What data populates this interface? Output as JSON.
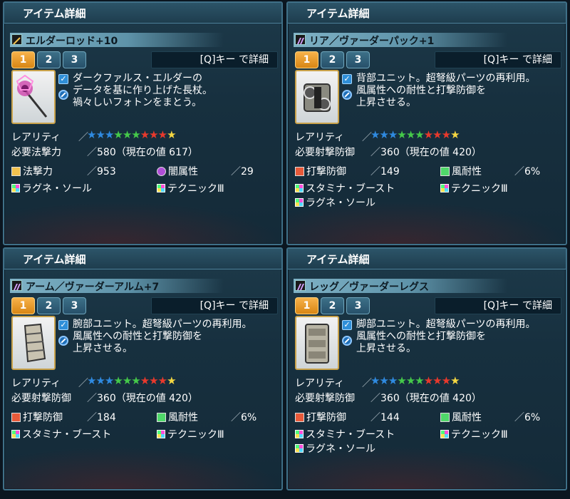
{
  "panels": [
    {
      "title": "アイテム詳細",
      "item_name": "エルダーロッド+10",
      "tabs": [
        "1",
        "2",
        "3"
      ],
      "detail_button": "[Q]キー で詳細",
      "description": "ダークファルス・エルダーの\nデータを基に作り上げた長杖。\n禍々しいフォトンをまとう。",
      "rarity_label": "レアリティ",
      "rarity_stars": 10,
      "req_label": "必要法撃力",
      "req_value": "580（現在の値 617）",
      "stat1_label": "法撃力",
      "stat1_value": "953",
      "stat2_label": "闇属性",
      "stat2_value": "29",
      "abilities": [
        "ラグネ・ソール",
        "テクニックⅢ"
      ],
      "thumb": "rod-icon"
    },
    {
      "title": "アイテム詳細",
      "item_name": "リア／ヴァーダーパック+1",
      "tabs": [
        "1",
        "2",
        "3"
      ],
      "detail_button": "[Q]キー で詳細",
      "description": "背部ユニット。超弩級パーツの再利用。\n風属性への耐性と打撃防御を\n上昇させる。",
      "rarity_label": "レアリティ",
      "rarity_stars": 10,
      "req_label": "必要射撃防御",
      "req_value": "360（現在の値 420）",
      "stat1_label": "打撃防御",
      "stat1_value": "149",
      "stat2_label": "風耐性",
      "stat2_value": "6%",
      "abilities": [
        "スタミナ・ブースト",
        "テクニックⅢ",
        "ラグネ・ソール"
      ],
      "thumb": "rear-unit-icon"
    },
    {
      "title": "アイテム詳細",
      "item_name": "アーム／ヴァーダーアルム+7",
      "tabs": [
        "1",
        "2",
        "3"
      ],
      "detail_button": "[Q]キー で詳細",
      "description": "腕部ユニット。超弩級パーツの再利用。\n風属性への耐性と打撃防御を\n上昇させる。",
      "rarity_label": "レアリティ",
      "rarity_stars": 10,
      "req_label": "必要射撃防御",
      "req_value": "360（現在の値 420）",
      "stat1_label": "打撃防御",
      "stat1_value": "184",
      "stat2_label": "風耐性",
      "stat2_value": "6%",
      "abilities": [
        "スタミナ・ブースト",
        "テクニックⅢ"
      ],
      "thumb": "arm-unit-icon"
    },
    {
      "title": "アイテム詳細",
      "item_name": "レッグ／ヴァーダーレグス",
      "tabs": [
        "1",
        "2",
        "3"
      ],
      "detail_button": "[Q]キー で詳細",
      "description": "脚部ユニット。超弩級パーツの再利用。\n風属性への耐性と打撃防御を\n上昇させる。",
      "rarity_label": "レアリティ",
      "rarity_stars": 10,
      "req_label": "必要射撃防御",
      "req_value": "360（現在の値 420）",
      "stat1_label": "打撃防御",
      "stat1_value": "144",
      "stat2_label": "風耐性",
      "stat2_value": "6%",
      "abilities": [
        "スタミナ・ブースト",
        "テクニックⅢ",
        "ラグネ・ソール"
      ],
      "thumb": "leg-unit-icon"
    }
  ],
  "star_colors": [
    "#2f8ae0",
    "#2f8ae0",
    "#2f8ae0",
    "#45c94a",
    "#45c94a",
    "#45c94a",
    "#e8392c",
    "#e8392c",
    "#e8392c",
    "#f5d742"
  ],
  "colors": {
    "accent_tab": "#f7b24a",
    "panel_bg": "#17303f",
    "name_bar": "#7fb2c6"
  }
}
